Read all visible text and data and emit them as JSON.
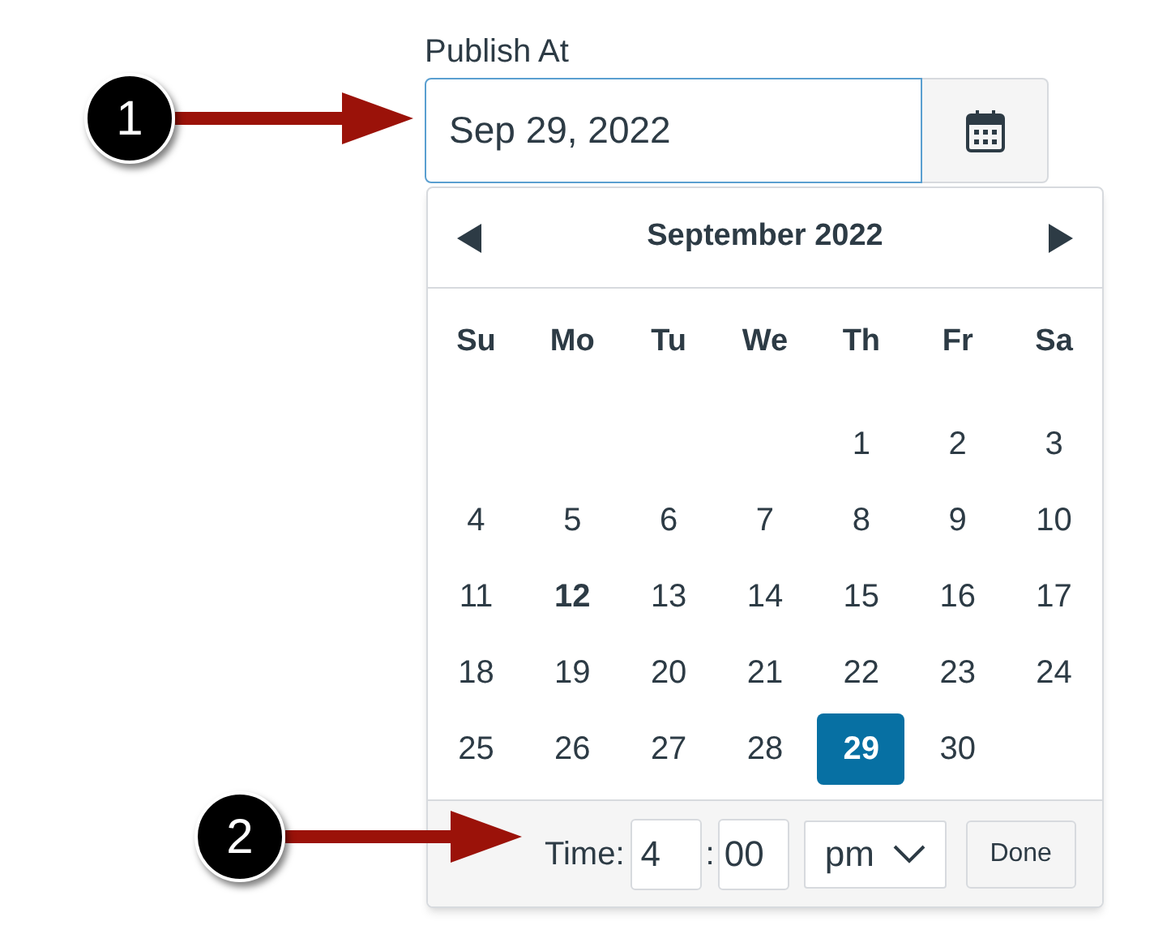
{
  "field": {
    "label": "Publish At",
    "value": "Sep 29, 2022"
  },
  "calendar": {
    "month_title": "September 2022",
    "weekdays": [
      "Su",
      "Mo",
      "Tu",
      "We",
      "Th",
      "Fr",
      "Sa"
    ],
    "weeks": [
      [
        {
          "kind": "blank"
        },
        {
          "kind": "blank"
        },
        {
          "kind": "blank"
        },
        {
          "kind": "blank"
        },
        {
          "kind": "day",
          "day": "1",
          "today": false,
          "selected": false
        },
        {
          "kind": "day",
          "day": "2",
          "today": false,
          "selected": false
        },
        {
          "kind": "day",
          "day": "3",
          "today": false,
          "selected": false
        }
      ],
      [
        {
          "kind": "day",
          "day": "4",
          "today": false,
          "selected": false
        },
        {
          "kind": "day",
          "day": "5",
          "today": false,
          "selected": false
        },
        {
          "kind": "day",
          "day": "6",
          "today": false,
          "selected": false
        },
        {
          "kind": "day",
          "day": "7",
          "today": false,
          "selected": false
        },
        {
          "kind": "day",
          "day": "8",
          "today": false,
          "selected": false
        },
        {
          "kind": "day",
          "day": "9",
          "today": false,
          "selected": false
        },
        {
          "kind": "day",
          "day": "10",
          "today": false,
          "selected": false
        }
      ],
      [
        {
          "kind": "day",
          "day": "11",
          "today": false,
          "selected": false
        },
        {
          "kind": "day",
          "day": "12",
          "today": true,
          "selected": false
        },
        {
          "kind": "day",
          "day": "13",
          "today": false,
          "selected": false
        },
        {
          "kind": "day",
          "day": "14",
          "today": false,
          "selected": false
        },
        {
          "kind": "day",
          "day": "15",
          "today": false,
          "selected": false
        },
        {
          "kind": "day",
          "day": "16",
          "today": false,
          "selected": false
        },
        {
          "kind": "day",
          "day": "17",
          "today": false,
          "selected": false
        }
      ],
      [
        {
          "kind": "day",
          "day": "18",
          "today": false,
          "selected": false
        },
        {
          "kind": "day",
          "day": "19",
          "today": false,
          "selected": false
        },
        {
          "kind": "day",
          "day": "20",
          "today": false,
          "selected": false
        },
        {
          "kind": "day",
          "day": "21",
          "today": false,
          "selected": false
        },
        {
          "kind": "day",
          "day": "22",
          "today": false,
          "selected": false
        },
        {
          "kind": "day",
          "day": "23",
          "today": false,
          "selected": false
        },
        {
          "kind": "day",
          "day": "24",
          "today": false,
          "selected": false
        }
      ],
      [
        {
          "kind": "day",
          "day": "25",
          "today": false,
          "selected": false
        },
        {
          "kind": "day",
          "day": "26",
          "today": false,
          "selected": false
        },
        {
          "kind": "day",
          "day": "27",
          "today": false,
          "selected": false
        },
        {
          "kind": "day",
          "day": "28",
          "today": false,
          "selected": false
        },
        {
          "kind": "day",
          "day": "29",
          "today": false,
          "selected": true
        },
        {
          "kind": "day",
          "day": "30",
          "today": false,
          "selected": false
        },
        {
          "kind": "blank"
        }
      ]
    ],
    "time": {
      "label": "Time:",
      "hour": "4",
      "separator": ":",
      "minute": "00",
      "meridiem": "pm",
      "done": "Done"
    }
  },
  "callouts": [
    {
      "number": "1"
    },
    {
      "number": "2"
    }
  ]
}
